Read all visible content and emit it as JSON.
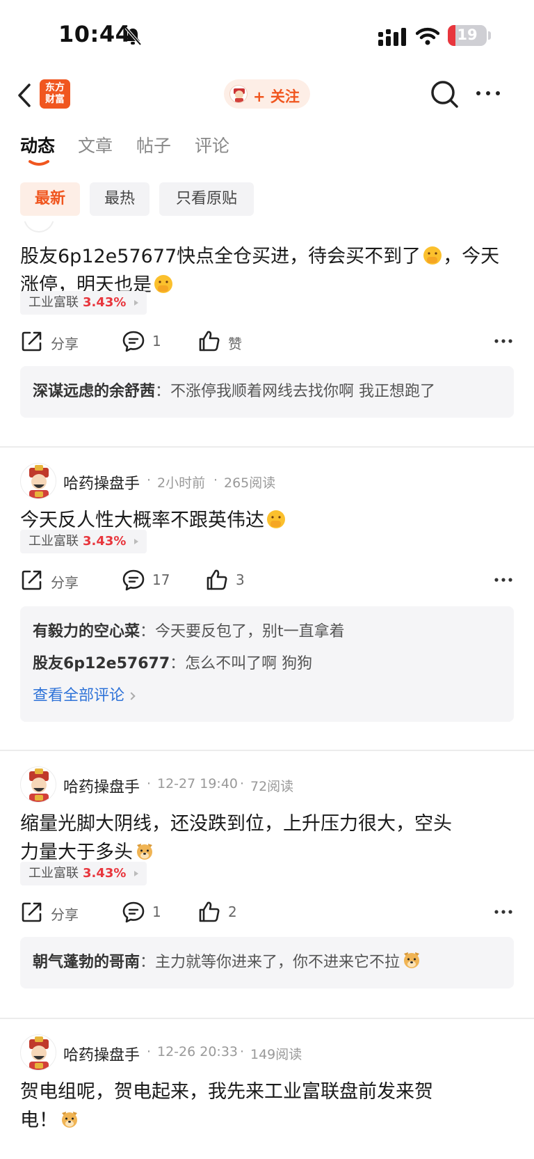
{
  "status_bar": {
    "time": "10:44",
    "battery_level": "19",
    "battery_fraction": 0.19,
    "colors": {
      "battery_low": "#e8363d"
    }
  },
  "header": {
    "logo_text": "东方财富",
    "follow_label": "+ 关注"
  },
  "tabs": [
    {
      "label": "动态",
      "active": true
    },
    {
      "label": "文章",
      "active": false
    },
    {
      "label": "帖子",
      "active": false
    },
    {
      "label": "评论",
      "active": false
    }
  ],
  "filters": [
    {
      "label": "最新",
      "active": true
    },
    {
      "label": "最热",
      "active": false
    },
    {
      "label": "只看原贴",
      "active": false
    }
  ],
  "colors": {
    "accent": "#f0561f",
    "stock_up": "#e8363d",
    "link": "#2f73d8"
  },
  "posts": [
    {
      "text_parts": [
        "股友6p12e57677快点全仓买进，待会买不到了",
        "，今天涨停，明天也是"
      ],
      "emoji": "hand-over-mouth-emoji",
      "stock": {
        "name": "工业富联",
        "change": "3.43%"
      },
      "share_label": "分享",
      "comment_count": "1",
      "like_label": "赞",
      "comments": [
        {
          "user": "深谋远虑的余舒茜",
          "sep": "：",
          "text": "不涨停我顺着网线去找你啊 我正想跑了"
        }
      ]
    },
    {
      "author": "哈药操盘手",
      "time": "2小时前",
      "reads": "265阅读",
      "text": "今天反人性大概率不跟英伟达",
      "emoji": "hand-over-mouth-emoji",
      "stock": {
        "name": "工业富联",
        "change": "3.43%"
      },
      "share_label": "分享",
      "comment_count": "17",
      "like_count": "3",
      "comments": [
        {
          "user": "有毅力的空心菜",
          "sep": "：",
          "text": "今天要反包了，别t一直拿着"
        },
        {
          "user": "股友6p12e57677",
          "sep": "：",
          "text": "怎么不叫了啊 狗狗"
        }
      ],
      "view_all": "查看全部评论"
    },
    {
      "author": "哈药操盘手",
      "time": "12-27 19:40",
      "reads": "72阅读",
      "text_parts": [
        "缩量光脚大阴线，还没跌到位，上升压力很大，空头",
        "力量大于多头"
      ],
      "emoji": "dog-face-emoji",
      "stock": {
        "name": "工业富联",
        "change": "3.43%"
      },
      "share_label": "分享",
      "comment_count": "1",
      "like_count": "2",
      "comments": [
        {
          "user": "朝气蓬勃的哥南",
          "sep": "：",
          "text": "主力就等你进来了，你不进来它不拉"
        }
      ]
    },
    {
      "author": "哈药操盘手",
      "time": "12-26 20:33",
      "reads": "149阅读",
      "text_parts": [
        "贺电组呢，贺电起来，我先来工业富联盘前发来贺",
        "电！"
      ],
      "emoji": "dog-face-emoji"
    }
  ]
}
